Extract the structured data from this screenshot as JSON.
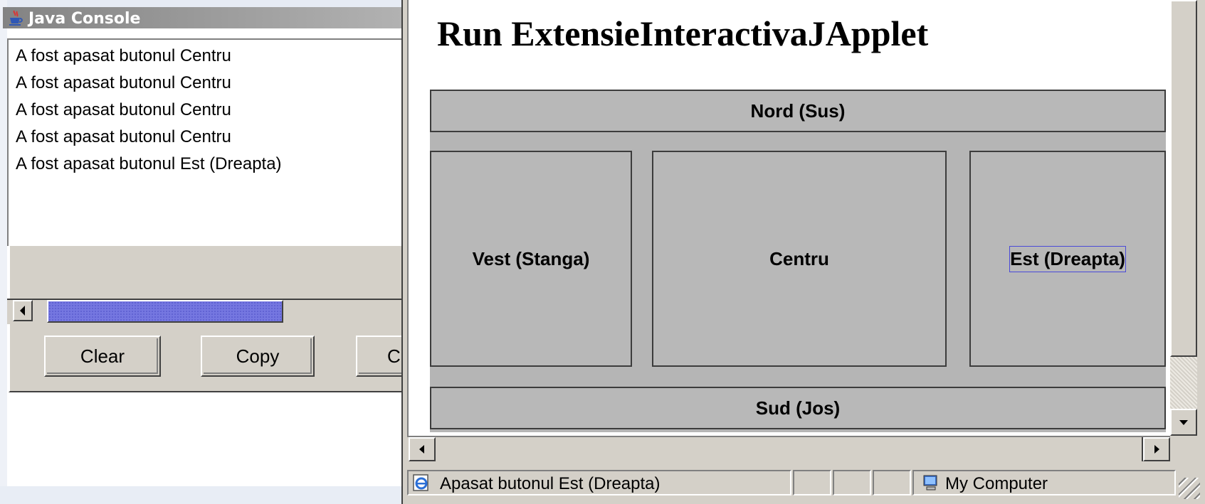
{
  "java_console": {
    "title": "Java Console",
    "lines": [
      "A fost apasat butonul Centru",
      "A fost apasat butonul Centru",
      "A fost apasat butonul Centru",
      "A fost apasat butonul Centru",
      "A fost apasat butonul Est (Dreapta)"
    ],
    "buttons": {
      "clear": "Clear",
      "copy": "Copy",
      "close_partial": "C"
    }
  },
  "browser": {
    "page_heading": "Run ExtensieInteractivaJApplet",
    "applet_buttons": {
      "north": "Nord (Sus)",
      "west": "Vest (Stanga)",
      "center": "Centru",
      "east": "Est (Dreapta)",
      "south": "Sud (Jos)"
    },
    "status_bar": {
      "message": "Apasat butonul Est (Dreapta)",
      "zone": "My Computer"
    }
  },
  "icons": {
    "java": "java-coffee-cup-icon",
    "ie_page": "ie-page-icon",
    "computer": "my-computer-icon"
  }
}
